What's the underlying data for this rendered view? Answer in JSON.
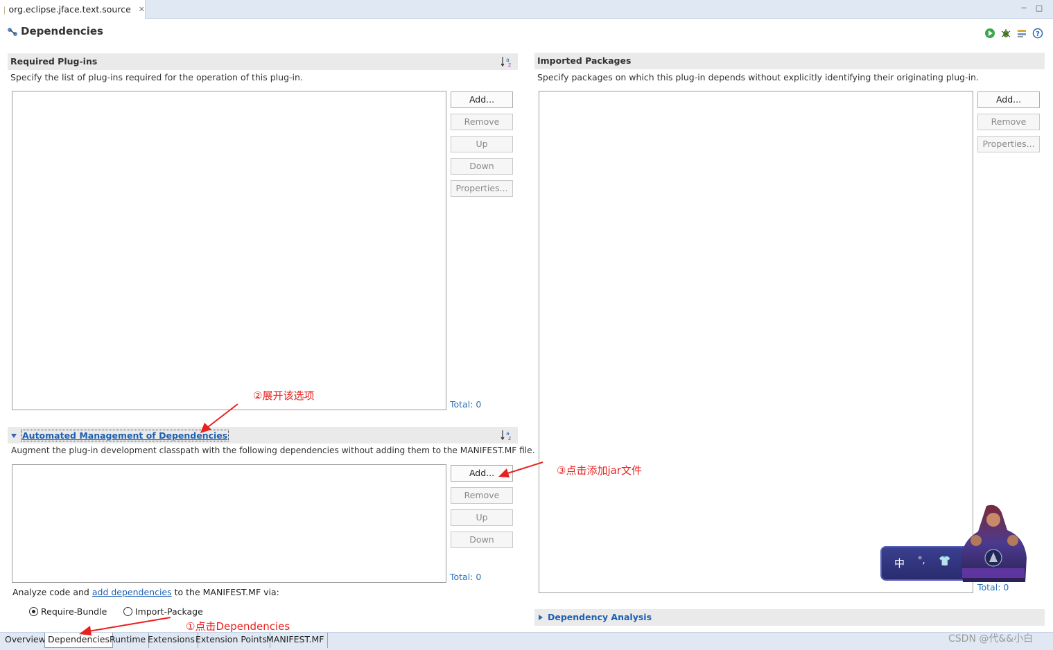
{
  "editor_tab": {
    "title": "org.eclipse.jface.text.source",
    "close": "✕"
  },
  "window_controls": {
    "minimize": "−",
    "maximize": "□"
  },
  "form": {
    "title": "Dependencies"
  },
  "required_plugins": {
    "title": "Required Plug-ins",
    "description": "Specify the list of plug-ins required for the operation of this plug-in.",
    "buttons": {
      "add": "Add...",
      "remove": "Remove",
      "up": "Up",
      "down": "Down",
      "properties": "Properties..."
    },
    "total": "Total: 0"
  },
  "automated_management": {
    "title": "Automated Management of Dependencies",
    "description": "Augment the plug-in development classpath with the following dependencies without adding them to the MANIFEST.MF file.",
    "buttons": {
      "add": "Add...",
      "remove": "Remove",
      "up": "Up",
      "down": "Down"
    },
    "total": "Total: 0",
    "analyze_prefix": "Analyze code and",
    "analyze_link": "add dependencies",
    "analyze_suffix": "to the MANIFEST.MF via:",
    "radio_require": "Require-Bundle",
    "radio_import": "Import-Package",
    "selected": "Require-Bundle"
  },
  "imported_packages": {
    "title": "Imported Packages",
    "description": "Specify packages on which this plug-in depends without explicitly identifying their originating plug-in.",
    "buttons": {
      "add": "Add...",
      "remove": "Remove",
      "properties": "Properties..."
    },
    "total": "Total: 0"
  },
  "dependency_analysis": {
    "title": "Dependency Analysis"
  },
  "page_tabs": [
    "Overview",
    "Dependencies",
    "Runtime",
    "Extensions",
    "Extension Points",
    "MANIFEST.MF"
  ],
  "active_page_tab": "Dependencies",
  "annotations": {
    "step1": "①点击Dependencies",
    "step2": "②展开该选项",
    "step3": "③点击添加jar文件"
  },
  "widget": {
    "ime": "中",
    "dot": "°,",
    "shirt": "👕"
  },
  "watermark": "CSDN @代&&小白",
  "colors": {
    "accent_link": "#1d5fb1",
    "annotation": "#e8211e",
    "tabbar": "#dfe8f3",
    "section_head": "#eaeaea"
  }
}
